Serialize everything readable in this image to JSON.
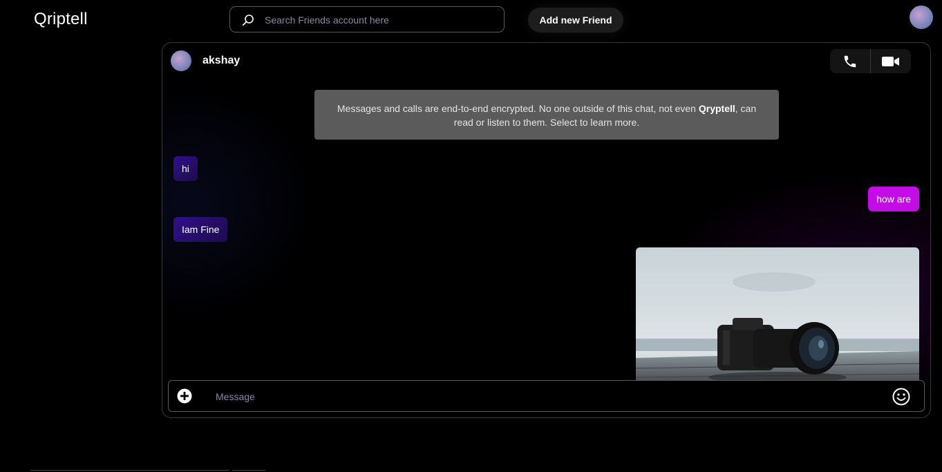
{
  "app": {
    "title": "Qriptell"
  },
  "header": {
    "search_placeholder": "Search Friends account here",
    "add_friend_label": "Add new Friend"
  },
  "chat": {
    "contact_name": "akshay",
    "notice": {
      "before": "Messages and calls are end-to-end encrypted. No one outside of this chat, not even ",
      "brand": "Qryptell",
      "after": ", can read or listen to them. Select to learn more."
    },
    "messages": [
      {
        "direction": "incoming",
        "text": "hi"
      },
      {
        "direction": "outgoing",
        "text": "how are"
      },
      {
        "direction": "incoming",
        "text": "Iam Fine"
      },
      {
        "direction": "outgoing",
        "type": "image",
        "subject": "camera-photo"
      }
    ],
    "composer": {
      "placeholder": "Message"
    }
  },
  "icons": [
    "search-icon",
    "phone-icon",
    "video-camera-icon",
    "plus-circle-icon",
    "emoji-icon",
    "avatar"
  ],
  "colors": {
    "background": "#000000",
    "incoming_bubble": "#2a0f7a",
    "outgoing_bubble": "#c40ce6",
    "notice_bg": "#5b5b5b"
  }
}
